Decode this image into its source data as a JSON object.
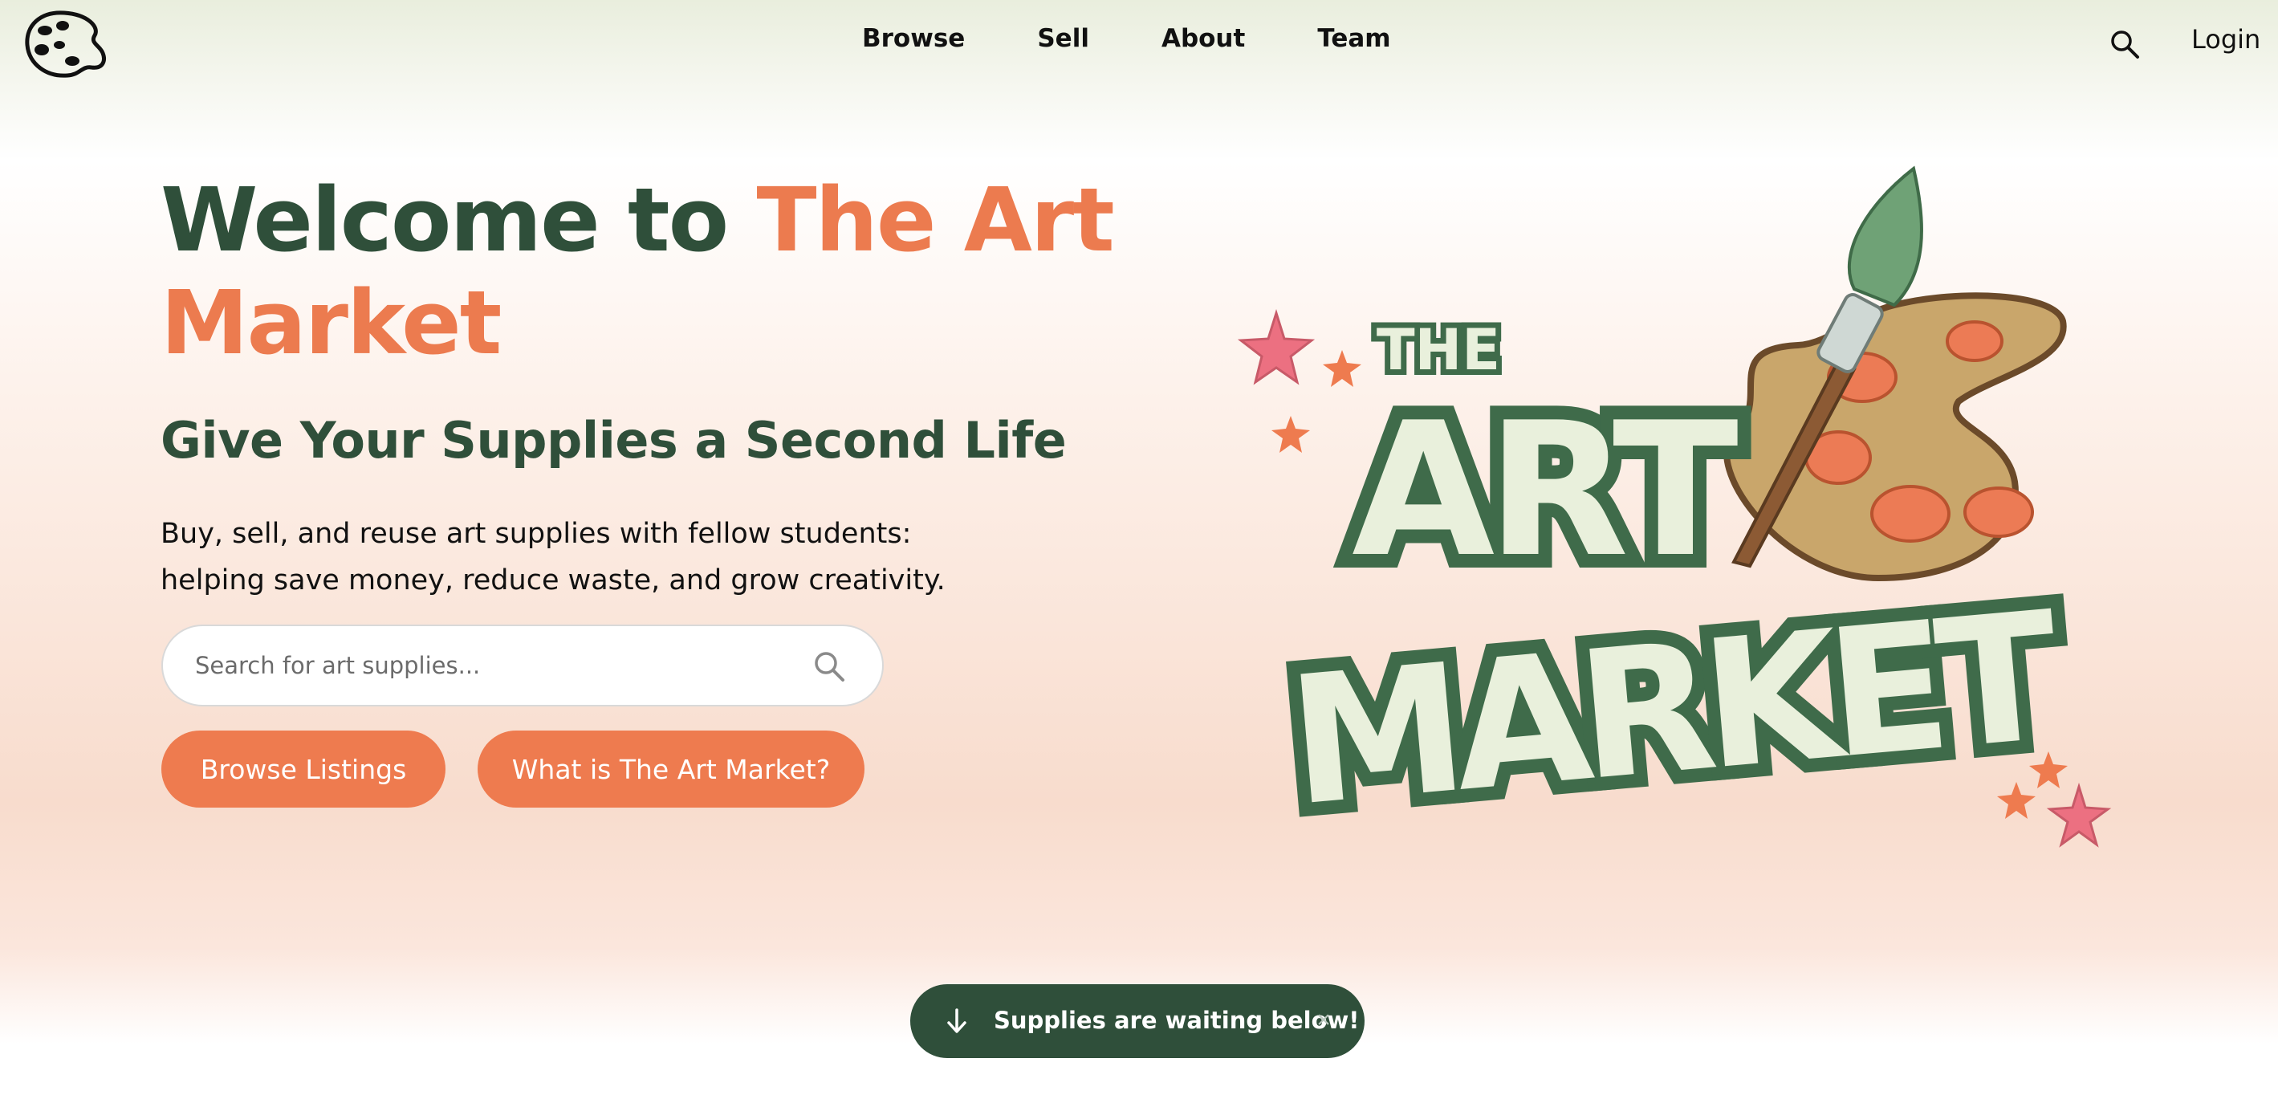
{
  "nav": {
    "logo_icon": "palette-icon",
    "links": [
      "Browse",
      "Sell",
      "About",
      "Team"
    ],
    "search_icon": "search-icon",
    "login": "Login"
  },
  "hero": {
    "title_part1": "Welcome to ",
    "title_part2": "The Art Market",
    "subtitle": "Give Your Supplies a Second Life",
    "description": "Buy, sell, and reuse art supplies with fellow students: helping save money, reduce waste, and grow creativity.",
    "search_placeholder": "Search for art supplies...",
    "browse_button": "Browse Listings",
    "what_button": "What is The Art Market?"
  },
  "art_logo": {
    "line1": "THE",
    "line2": "ART",
    "line3": "MARKET"
  },
  "toast": {
    "text": "Supplies are waiting below!",
    "close": "×",
    "arrow_icon": "arrow-down-icon"
  },
  "colors": {
    "brand_green": "#2f4f3a",
    "accent_orange": "#ec7b4f"
  }
}
